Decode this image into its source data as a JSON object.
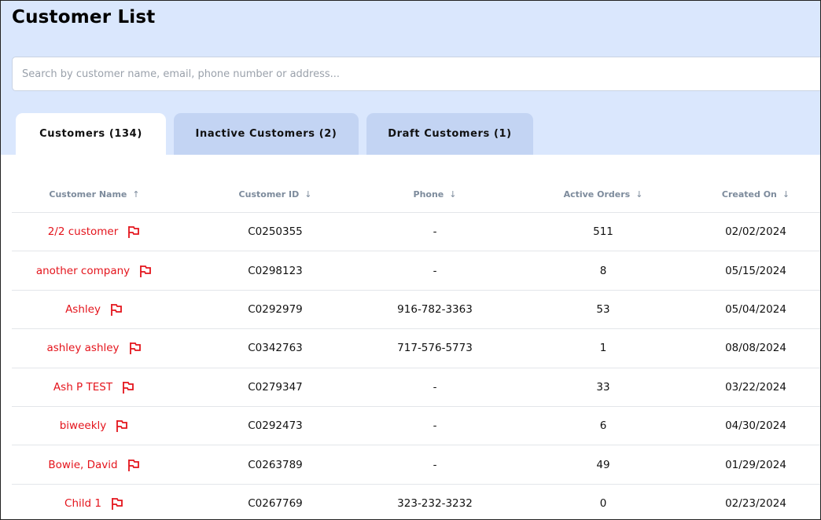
{
  "page": {
    "title": "Customer List"
  },
  "search": {
    "placeholder": "Search by customer name, email, phone number or address..."
  },
  "tabs": [
    {
      "label": "Customers (134)",
      "active": true
    },
    {
      "label": "Inactive Customers (2)",
      "active": false
    },
    {
      "label": "Draft Customers (1)",
      "active": false
    }
  ],
  "colors": {
    "header_bg": "#dae7fd",
    "tab_inactive_bg": "#c3d4f3",
    "name_link": "#e4141c",
    "column_header_text": "#7d8b9c"
  },
  "table": {
    "columns": [
      {
        "label": "Customer Name",
        "sort_icon": "arrow-up-icon"
      },
      {
        "label": "Customer ID",
        "sort_icon": "arrow-down-icon"
      },
      {
        "label": "Phone",
        "sort_icon": "arrow-down-icon"
      },
      {
        "label": "Active Orders",
        "sort_icon": "arrow-down-icon"
      },
      {
        "label": "Created On",
        "sort_icon": "arrow-down-icon"
      }
    ],
    "rows": [
      {
        "name": "2/2 customer",
        "id": "C0250355",
        "phone": "-",
        "orders": "511",
        "created": "02/02/2024"
      },
      {
        "name": "another company",
        "id": "C0298123",
        "phone": "-",
        "orders": "8",
        "created": "05/15/2024"
      },
      {
        "name": "Ashley",
        "id": "C0292979",
        "phone": "916-782-3363",
        "orders": "53",
        "created": "05/04/2024"
      },
      {
        "name": "ashley ashley",
        "id": "C0342763",
        "phone": "717-576-5773",
        "orders": "1",
        "created": "08/08/2024"
      },
      {
        "name": "Ash P TEST",
        "id": "C0279347",
        "phone": "-",
        "orders": "33",
        "created": "03/22/2024"
      },
      {
        "name": "biweekly",
        "id": "C0292473",
        "phone": "-",
        "orders": "6",
        "created": "04/30/2024"
      },
      {
        "name": "Bowie, David",
        "id": "C0263789",
        "phone": "-",
        "orders": "49",
        "created": "01/29/2024"
      },
      {
        "name": "Child 1",
        "id": "C0267769",
        "phone": "323-232-3232",
        "orders": "0",
        "created": "02/23/2024"
      }
    ]
  }
}
